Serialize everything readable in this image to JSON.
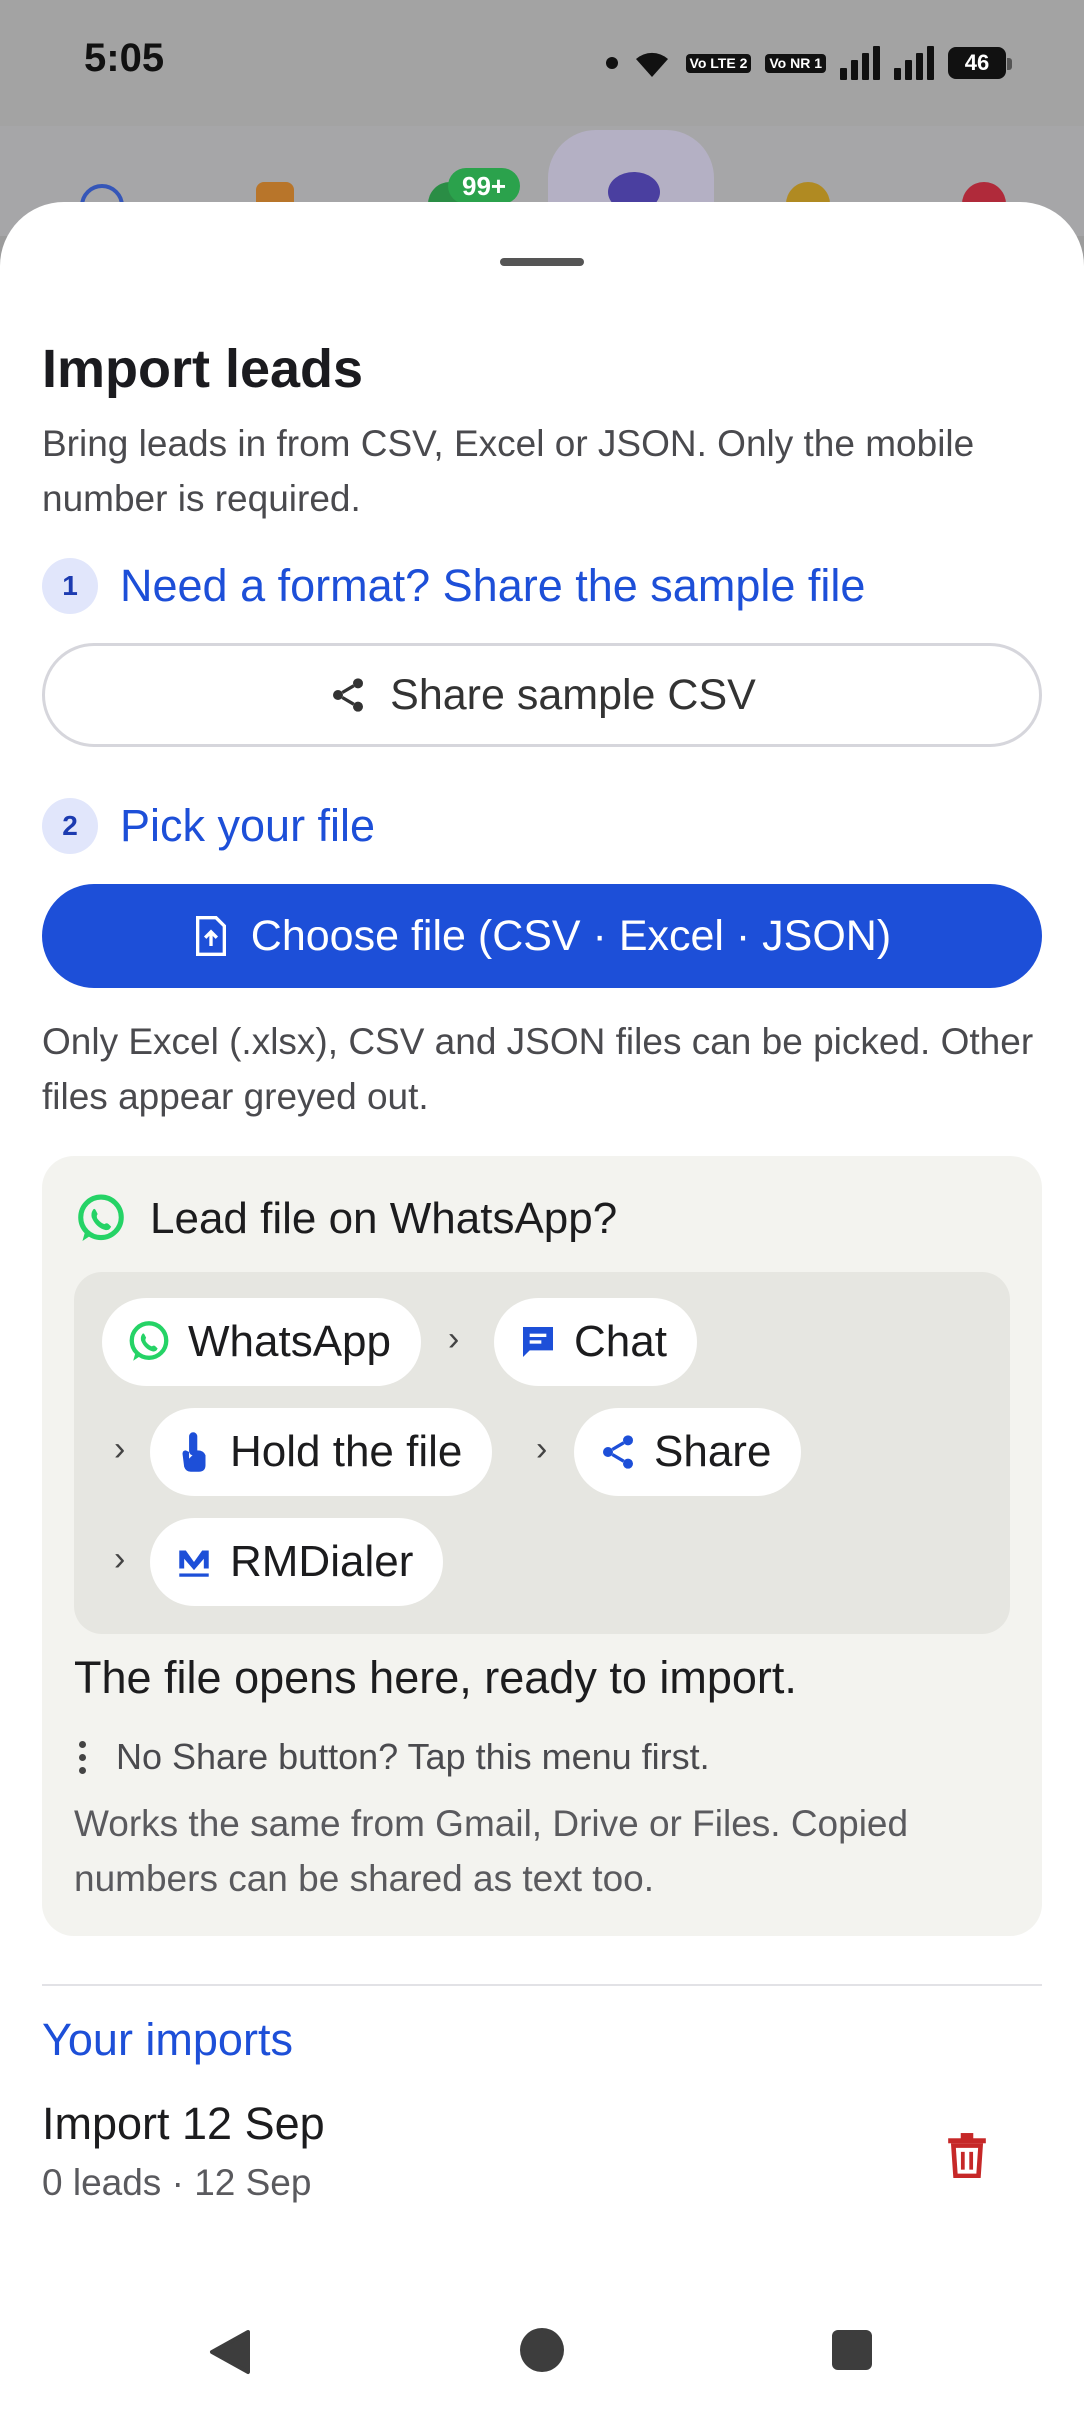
{
  "status_bar": {
    "time": "5:05",
    "sim1": "Vo LTE 2",
    "sim2": "Vo NR 1",
    "battery": "46"
  },
  "background_tabs": {
    "badge": "99+",
    "icons": [
      "clock-icon",
      "clipboard-icon",
      "phone-icon",
      "people-icon",
      "dollar-icon",
      "alarm-icon"
    ]
  },
  "sheet": {
    "title": "Import leads",
    "subtitle": "Bring leads in from CSV, Excel or JSON. Only the mobile number is required.",
    "step1": {
      "number": "1",
      "label": "Need a format? Share the sample file"
    },
    "share_button": "Share sample CSV",
    "step2": {
      "number": "2",
      "label": "Pick your file"
    },
    "choose_button": "Choose file (CSV · Excel · JSON)",
    "note": "Only Excel (.xlsx), CSV and JSON files can be picked. Other files appear greyed out.",
    "whatsapp_card": {
      "heading": "Lead file on WhatsApp?",
      "flow": [
        "WhatsApp",
        "Chat",
        "Hold the file",
        "Share",
        "RMDialer"
      ],
      "result": "The file opens here, ready to import.",
      "hint": "No Share button? Tap this menu first.",
      "footer": "Works the same from Gmail, Drive or Files. Copied numbers can be shared as text too."
    },
    "imports": {
      "title": "Your imports",
      "items": [
        {
          "name": "Import 12 Sep",
          "meta": "0 leads · 12 Sep"
        }
      ]
    }
  },
  "colors": {
    "accent": "#1d4fd8",
    "whatsapp": "#25d366",
    "danger": "#c62828"
  }
}
